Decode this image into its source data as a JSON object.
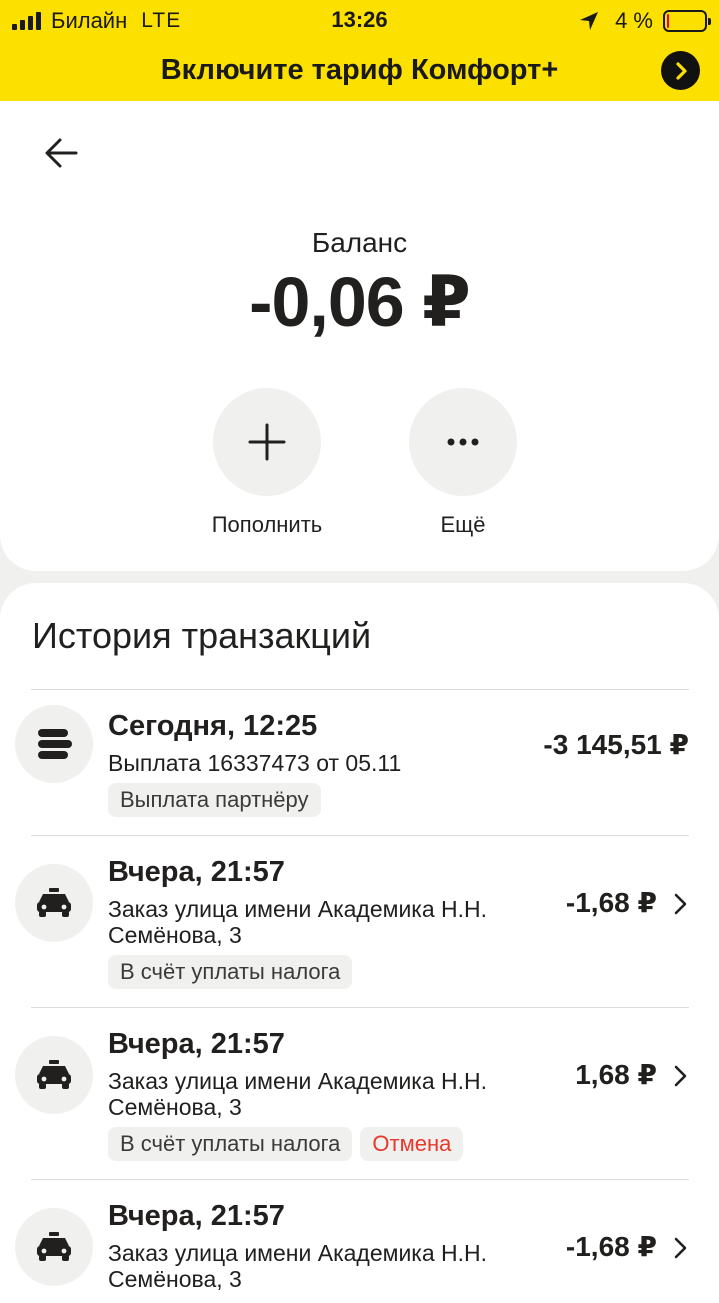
{
  "status": {
    "carrier": "Билайн",
    "network": "LTE",
    "time": "13:26",
    "battery_percent": "4 %",
    "battery_level": 0.04
  },
  "promo": {
    "text": "Включите тариф Комфорт+"
  },
  "balance": {
    "label": "Баланс",
    "value": "-0,06 ₽"
  },
  "actions": [
    {
      "label": "Пополнить",
      "icon": "plus-icon"
    },
    {
      "label": "Ещё",
      "icon": "more-dots-icon"
    }
  ],
  "history": {
    "title": "История транзакций",
    "items": [
      {
        "date": "Сегодня, 12:25",
        "desc": "Выплата 16337473 от 05.11",
        "tags": [
          "Выплата партнёру"
        ],
        "amount": "-3 145,51 ₽",
        "icon": "wallet-icon"
      },
      {
        "date": "Вчера, 21:57",
        "desc": "Заказ улица имени Академика Н.Н. Семёнова, 3",
        "tags": [
          "В счёт уплаты налога"
        ],
        "amount": "-1,68 ₽",
        "icon": "taxi-icon"
      },
      {
        "date": "Вчера, 21:57",
        "desc": "Заказ улица имени Академика Н.Н. Семёнова, 3",
        "tags": [
          "В счёт уплаты налога"
        ],
        "cancel_tag": "Отмена",
        "amount": "1,68 ₽",
        "icon": "taxi-icon"
      },
      {
        "date": "Вчера, 21:57",
        "desc": "Заказ улица имени Академика Н.Н. Семёнова, 3",
        "amount": "-1,68 ₽",
        "icon": "taxi-icon"
      }
    ]
  },
  "colors": {
    "accent_yellow": "#fce000",
    "cancel_red": "#e8372b"
  }
}
